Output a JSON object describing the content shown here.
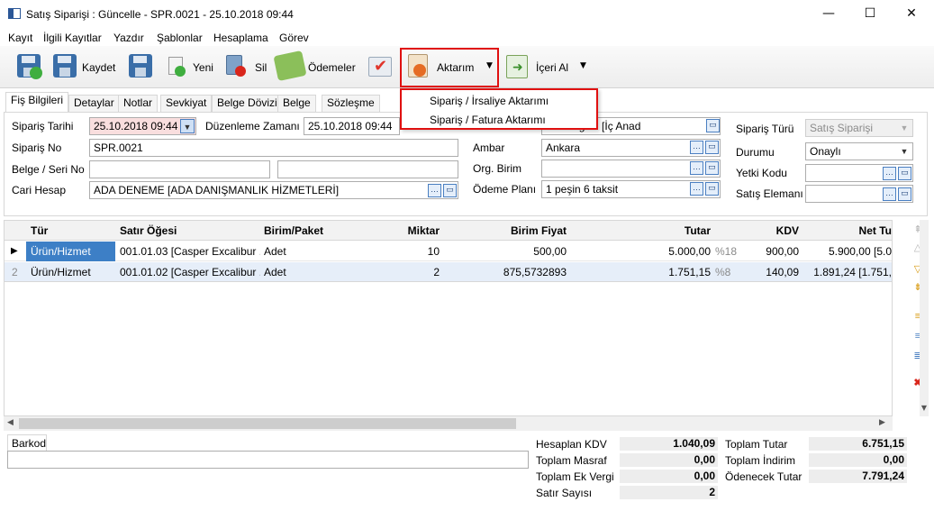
{
  "window": {
    "title": "Satış Siparişi : Güncelle - SPR.0021 - 25.10.2018 09:44",
    "minimize": "—",
    "maximize": "☐",
    "close": "✕"
  },
  "menu": [
    "Kayıt",
    "İlgili Kayıtlar",
    "Yazdır",
    "Şablonlar",
    "Hesaplama",
    "Görev"
  ],
  "toolbar": {
    "save": "Kaydet",
    "new": "Yeni",
    "delete": "Sil",
    "payments": "Ödemeler",
    "transfer": "Aktarım",
    "import": "İçeri Al"
  },
  "transfer_menu": {
    "items": [
      "Sipariş / İrsaliye Aktarımı",
      "Sipariş / Fatura Aktarımı"
    ]
  },
  "tabs": [
    "Fiş Bilgileri",
    "Detaylar",
    "Notlar",
    "Sevkiyat",
    "Belge Dövizi",
    "Belge",
    "Sözleşme"
  ],
  "form": {
    "order_date_label": "Sipariş Tarihi",
    "order_date": "25.10.2018 09:44",
    "edit_time_label": "Düzenleme Zamanı",
    "edit_time": "25.10.2018 09:44",
    "order_no_label": "Sipariş No",
    "order_no": "SPR.0021",
    "doc_serial_label": "Belge / Seri No",
    "doc_no": "",
    "serial_no": "",
    "account_label": "Cari Hesap",
    "account": "ADA DENEME [ADA DANIŞMANLIK HİZMETLERİ]",
    "region_partial": "olu Bölgesi [İç Anad",
    "warehouse_label": "Ambar",
    "warehouse": "Ankara",
    "org_unit_label": "Org. Birim",
    "org_unit": "",
    "payment_plan_label": "Ödeme Planı",
    "payment_plan": "1 peşin 6 taksit",
    "order_type_label": "Sipariş Türü",
    "order_type": "Satış Siparişi",
    "status_label": "Durumu",
    "status": "Onaylı",
    "auth_code_label": "Yetki Kodu",
    "auth_code": "",
    "sales_rep_label": "Satış Elemanı",
    "sales_rep": ""
  },
  "grid": {
    "headers": [
      "Tür",
      "Satır Öğesi",
      "Birim/Paket",
      "Miktar",
      "Birim Fiyat",
      "Tutar",
      "KDV",
      "Net Tu"
    ],
    "rows": [
      {
        "marker": "▶",
        "type": "Ürün/Hizmet",
        "item": "001.01.03 [Casper Excalibur ...",
        "unit": "Adet",
        "qty": "10",
        "price": "500,00",
        "amount": "5.000,00",
        "vat_rate": "%18",
        "vat": "900,00",
        "net": "5.900,00 [5.0"
      },
      {
        "marker": "2",
        "type": "Ürün/Hizmet",
        "item": "001.01.02 [Casper Excalibur ...",
        "unit": "Adet",
        "qty": "2",
        "price": "875,5732893",
        "amount": "1.751,15",
        "vat_rate": "%8",
        "vat": "140,09",
        "net": "1.891,24 [1.751,"
      }
    ]
  },
  "barcode_label": "Barkod",
  "summary": {
    "calc_vat_label": "Hesaplan KDV",
    "calc_vat": "1.040,09",
    "total_expense_label": "Toplam Masraf",
    "total_expense": "0,00",
    "extra_tax_label": "Toplam Ek Vergi",
    "extra_tax": "0,00",
    "row_count_label": "Satır Sayısı",
    "row_count": "2",
    "total_label": "Toplam Tutar",
    "total": "6.751,15",
    "discount_label": "Toplam İndirim",
    "discount": "0,00",
    "payable_label": "Ödenecek Tutar",
    "payable": "7.791,24"
  }
}
